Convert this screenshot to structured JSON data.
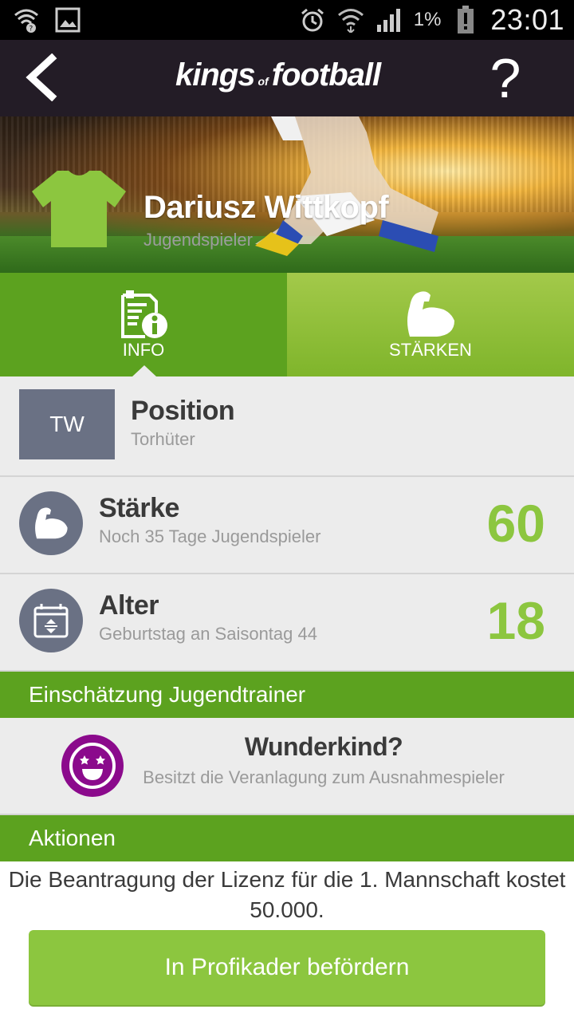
{
  "status_bar": {
    "battery_percent": "1%",
    "time": "23:01",
    "icons": [
      "wifi-question-icon",
      "image-icon",
      "alarm-icon",
      "wifi-icon",
      "signal-icon",
      "battery-alert-icon"
    ]
  },
  "app_bar": {
    "logo_part1": "kings",
    "logo_part2": "of",
    "logo_part3": "football",
    "help_label": "?"
  },
  "player": {
    "name": "Dariusz Wittkopf",
    "status": "Jugendspieler",
    "jersey_color": "#8cc63f"
  },
  "tabs": [
    {
      "label": "INFO",
      "active": true,
      "icon": "info-document-icon"
    },
    {
      "label": "STÄRKEN",
      "active": false,
      "icon": "bicep-icon"
    }
  ],
  "rows": {
    "position": {
      "badge": "TW",
      "title": "Position",
      "subtitle": "Torhüter"
    },
    "strength": {
      "title": "Stärke",
      "subtitle": "Noch 35 Tage Jugendspieler",
      "value": "60"
    },
    "age": {
      "title": "Alter",
      "subtitle": "Geburtstag an Saisontag 44",
      "value": "18"
    }
  },
  "assessment": {
    "header": "Einschätzung Jugendtrainer",
    "title": "Wunderkind?",
    "subtitle": "Besitzt die Veranlagung zum Ausnahmespieler",
    "icon_color": "#8b0a8c"
  },
  "actions": {
    "header": "Aktionen",
    "license_text": "Die Beantragung der Lizenz für die 1. Mannschaft kostet 50.000.",
    "promote_label": "In Profikader befördern"
  },
  "colors": {
    "green_dark": "#5ca21f",
    "green_light": "#8cc63f",
    "appbar": "#231c26",
    "badge_gray": "#6a7184"
  }
}
